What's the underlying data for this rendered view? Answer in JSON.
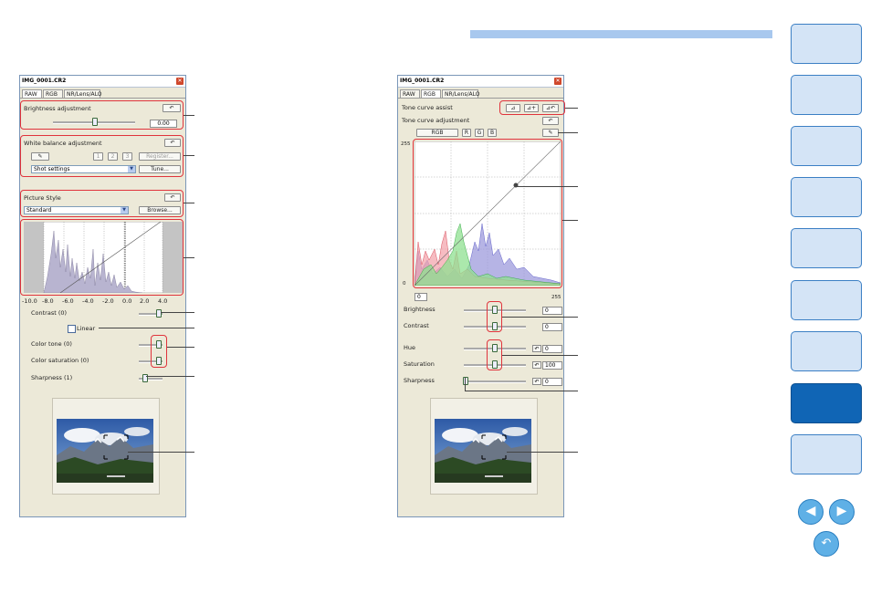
{
  "header": {
    "accent_color": "#a8c8ee"
  },
  "left_window": {
    "title": "IMG_0001.CR2",
    "tabs": [
      "RAW",
      "RGB",
      "NR/Lens/ALO"
    ],
    "brightness_label": "Brightness adjustment",
    "brightness_value": "0.00",
    "wb_label": "White balance adjustment",
    "wb_presets": [
      "1",
      "2",
      "3"
    ],
    "register_label": "Register...",
    "wb_select": "Shot settings",
    "tune_label": "Tune...",
    "picture_style_label": "Picture Style",
    "picture_style_select": "Standard",
    "browse_label": "Browse...",
    "axis_ticks": [
      "-10.0",
      "-8.0",
      "-6.0",
      "-4.0",
      "-2.0",
      "0.0",
      "2.0",
      "4.0"
    ],
    "contrast_label": "Contrast (0)",
    "linear_label": "Linear",
    "color_tone_label": "Color tone (0)",
    "color_saturation_label": "Color saturation (0)",
    "sharpness_label": "Sharpness (1)"
  },
  "right_window": {
    "title": "IMG_0001.CR2",
    "tabs": [
      "RAW",
      "RGB",
      "NR/Lens/ALO"
    ],
    "tone_curve_assist_label": "Tone curve assist",
    "tone_curve_adjustment_label": "Tone curve adjustment",
    "channel_buttons": [
      "RGB",
      "R",
      "G",
      "B"
    ],
    "curve_top_label": "255",
    "curve_bottom_label": "0",
    "input_low": "0",
    "input_high": "255",
    "brightness_label": "Brightness",
    "brightness_value": "0",
    "contrast_label": "Contrast",
    "contrast_value": "0",
    "hue_label": "Hue",
    "hue_value": "0",
    "saturation_label": "Saturation",
    "saturation_value": "100",
    "sharpness_label": "Sharpness",
    "sharpness_value": "0"
  },
  "navigation": {
    "items": 9,
    "active_index": 7,
    "prev_icon": "arrow-left-icon",
    "next_icon": "arrow-right-icon",
    "return_icon": "return-icon"
  }
}
